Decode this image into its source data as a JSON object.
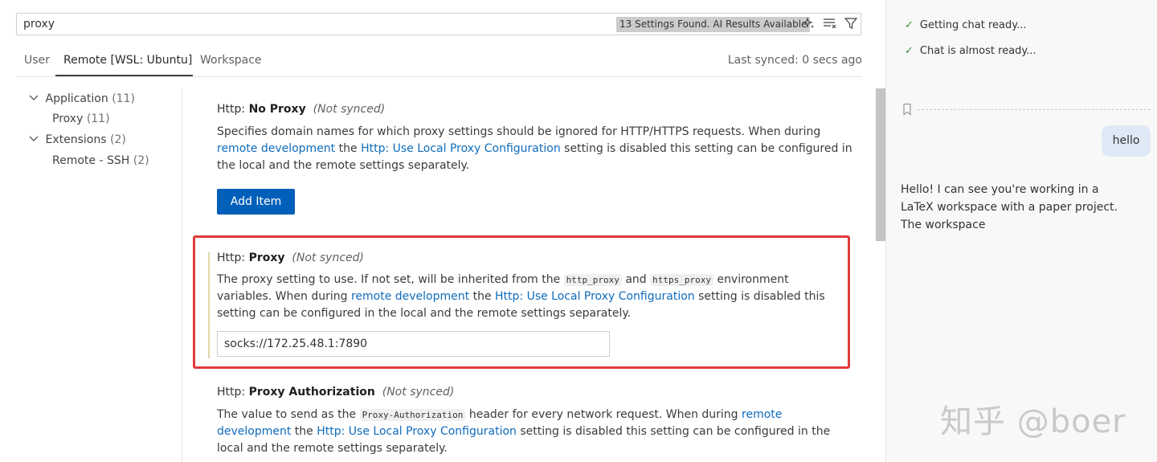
{
  "search": {
    "value": "proxy",
    "badge": "13 Settings Found. AI Results Available",
    "icons": [
      "sparkle-icon",
      "clear-filter-icon",
      "filter-icon"
    ]
  },
  "tabs": [
    "User",
    "Remote [WSL: Ubuntu]",
    "Workspace"
  ],
  "active_tab": "Remote [WSL: Ubuntu]",
  "last_synced": "Last synced: 0 secs ago",
  "toc": [
    {
      "label": "Application",
      "count": "(11)"
    },
    {
      "label": "Proxy",
      "count": "(11)"
    },
    {
      "label": "Extensions",
      "count": "(2)"
    },
    {
      "label": "Remote - SSH",
      "count": "(2)"
    }
  ],
  "settings": {
    "no_proxy": {
      "category": "Http: ",
      "name": "No Proxy",
      "tag": "(Not synced)",
      "line1_a": "Specifies domain names for which proxy settings should be ignored for HTTP/HTTPS requests. When during ",
      "link_remote": "remote development",
      "line_the": " the ",
      "link_config": "Http: Use Local Proxy Configuration",
      "line_end": " setting is disabled this setting can be configured in the local and the remote settings separately.",
      "button": "Add Item"
    },
    "proxy": {
      "category": "Http: ",
      "name": "Proxy",
      "tag": "(Not synced)",
      "text_a": "The proxy setting to use. If not set, will be inherited from the ",
      "code1": "http_proxy",
      "text_and": " and ",
      "code2": "https_proxy",
      "text_b": " environment variables. When during ",
      "link_remote": "remote development",
      "text_the": " the ",
      "link_config": "Http: Use Local Proxy Configuration",
      "text_end": " setting is disabled this setting can be configured in the local and the remote settings separately.",
      "value": "socks://172.25.48.1:7890"
    },
    "proxy_auth": {
      "category": "Http: ",
      "name": "Proxy Authorization",
      "tag": "(Not synced)",
      "text_a": "The value to send as the ",
      "code1": "Proxy-Authorization",
      "text_b": " header for every network request. When during ",
      "link_remote": "remote development",
      "text_the": " the ",
      "link_config": "Http: Use Local Proxy Configuration",
      "text_end": " setting is disabled this setting can be configured in the local and the remote settings separately."
    }
  },
  "chat": {
    "status1": "Getting chat ready...",
    "status2": "Chat is almost ready...",
    "user_message": "hello",
    "reply": "Hello! I can see you're working in a LaTeX workspace with a paper project. The workspace"
  },
  "watermark": "知乎 @boer",
  "colors": {
    "link": "#0f6cbd",
    "button": "#005fb8",
    "highlight_border": "#e03a3a"
  }
}
